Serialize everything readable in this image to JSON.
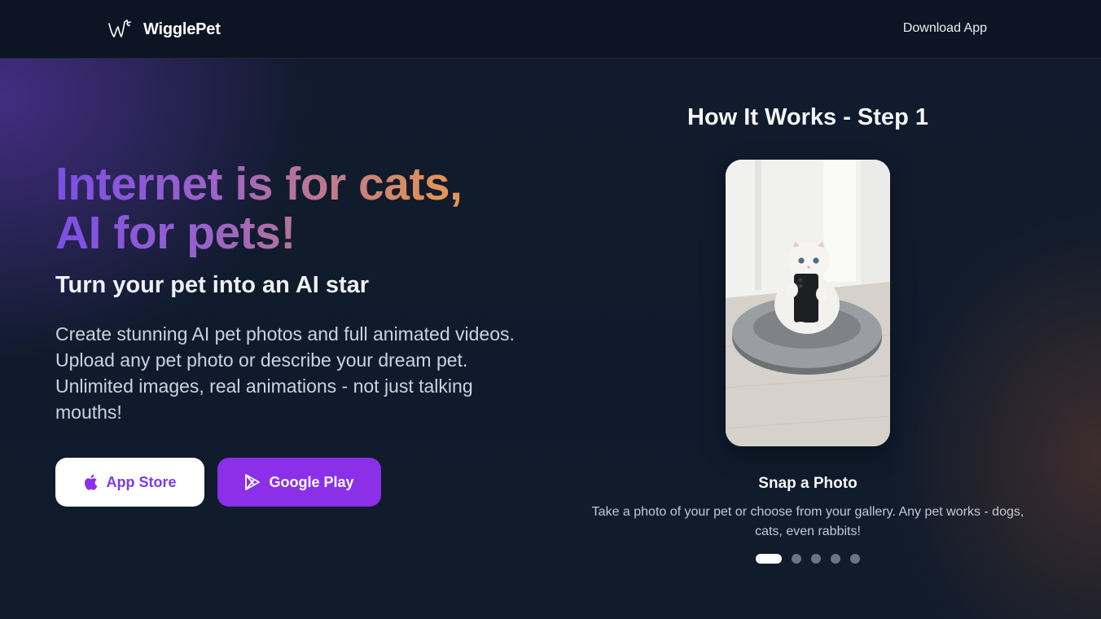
{
  "header": {
    "brand_name": "WigglePet",
    "logo_icon": "wigglepet-logo-icon",
    "download_label": "Download App"
  },
  "hero": {
    "headline_line1": "Internet is for cats,",
    "headline_line2": "AI for pets!",
    "subheadline": "Turn your pet into an AI star",
    "description": "Create stunning AI pet photos and full animated videos. Upload any pet photo or describe your dream pet. Unlimited images, real animations - not just talking mouths!",
    "buttons": {
      "app_store": {
        "label": "App Store",
        "icon": "apple-icon"
      },
      "google_play": {
        "label": "Google Play",
        "icon": "google-play-icon"
      }
    }
  },
  "how_it_works": {
    "title": "How It Works - Step 1",
    "current_step": 1,
    "total_steps": 5,
    "step_title": "Snap a Photo",
    "step_description": "Take a photo of your pet or choose from your gallery. Any pet works - dogs, cats, even rabbits!"
  },
  "colors": {
    "accent_purple": "#8b2fe8",
    "headline_gradient_start": "#7b4fe6",
    "headline_gradient_end": "#f0a14a",
    "background": "#0f1a2b"
  }
}
